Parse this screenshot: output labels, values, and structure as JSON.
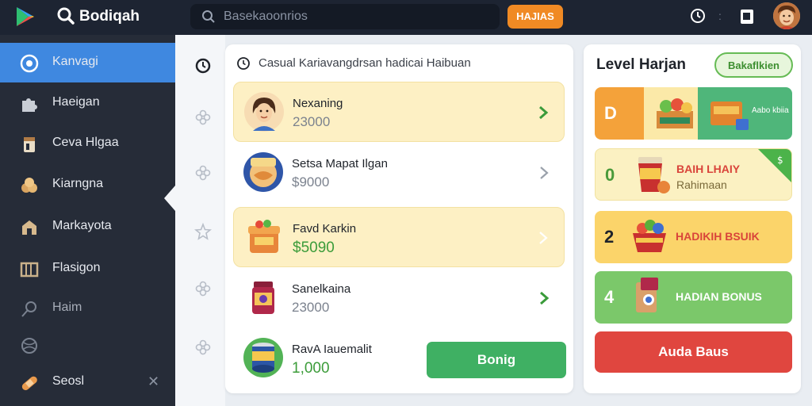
{
  "header": {
    "brand": "Bodiqah",
    "search_placeholder": "Basekaoonrios",
    "action_label": "HAJIAS"
  },
  "sidebar": {
    "items": [
      {
        "label": "Kanvagi",
        "icon": "compass-icon",
        "active": true
      },
      {
        "label": "Haeigan",
        "icon": "puzzle-icon"
      },
      {
        "label": "Ceva Hlgaa",
        "icon": "clipboard-icon"
      },
      {
        "label": "Kiarngna",
        "icon": "coins-icon"
      },
      {
        "label": "Markayota",
        "icon": "store-icon"
      },
      {
        "label": "Flasigon",
        "icon": "film-icon"
      },
      {
        "label": "Haim",
        "icon": "magnifier-icon",
        "dim": true
      },
      {
        "label": "",
        "icon": "ball-icon"
      },
      {
        "label": "Seosl",
        "icon": "bandage-icon"
      }
    ],
    "close_glyph": "✕"
  },
  "main": {
    "title": "Casual Kariavangdrsan hadicai Haibuan",
    "rows": [
      {
        "name": "Nexaning",
        "price": "23000",
        "highlight": true,
        "thumb": "girl-avatar-icon"
      },
      {
        "name": "Setsa Mapat Ilgan",
        "price": "$9000",
        "highlight": false,
        "thumb": "snack-badge-icon"
      },
      {
        "name": "Favd Karkin",
        "price": "$5090",
        "highlight": true,
        "price_green": true,
        "thumb": "treasure-box-icon"
      },
      {
        "name": "Sanelkaina",
        "price": "23000",
        "highlight": false,
        "thumb": "jar-icon"
      },
      {
        "name": "RavA Iauemalit",
        "price": "1,000",
        "highlight": false,
        "price_green": true,
        "thumb": "can-icon",
        "button": "Bonig"
      }
    ]
  },
  "right": {
    "title": "Level Harjan",
    "button": "Bakaflkien",
    "cards": [
      {
        "num": "D",
        "line1": "",
        "line2": "Aabo kbiia",
        "bg": "#f4a23a",
        "art": "bread-crate-icon"
      },
      {
        "num": "0",
        "line1": "BAIH LHAIY",
        "line2": "Rahimaan",
        "bg": "#fbf1c2",
        "art": "drink-cup-icon"
      },
      {
        "num": "2",
        "line1": "HADIKIH BSUIK",
        "line2": "",
        "bg": "#fbd46a",
        "art": "gift-basket-icon"
      },
      {
        "num": "4",
        "line1": "HADIAN BONUS",
        "line2": "",
        "bg": "#7bc86a",
        "art": "box-bag-icon"
      }
    ],
    "bonus_button": "Auda Baus"
  },
  "colors": {
    "topbar": "#1d2432",
    "sidebar": "#262c38",
    "active": "#3f88e0",
    "accent_orange": "#f08a24",
    "green_button": "#3fb063",
    "red_button": "#e0463f"
  }
}
